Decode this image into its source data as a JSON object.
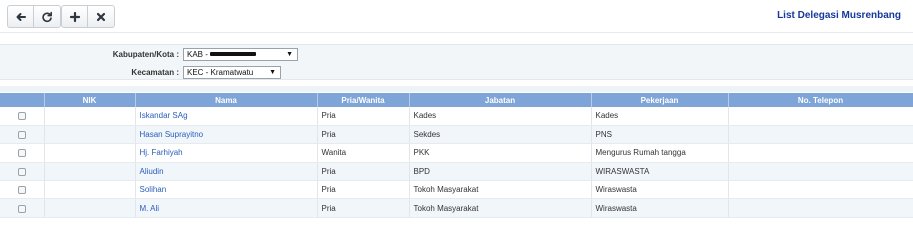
{
  "toolbar": {
    "back_icon": "arrow-left-icon",
    "refresh_icon": "refresh-icon",
    "add_icon": "plus-icon",
    "close_icon": "close-icon"
  },
  "page": {
    "title": "List Delegasi Musrenbang"
  },
  "filters": {
    "kabupaten": {
      "label": "Kabupaten/Kota :",
      "value": "KAB -"
    },
    "kecamatan": {
      "label": "Kecamatan :",
      "value": "KEC - Kramatwatu"
    }
  },
  "table": {
    "columns": [
      "NIK",
      "Nama",
      "Pria/Wanita",
      "Jabatan",
      "Pekerjaan",
      "No. Telepon"
    ],
    "rows": [
      {
        "nik": "",
        "nama": "Iskandar SAg",
        "gender": "Pria",
        "jabatan": "Kades",
        "pekerjaan": "Kades",
        "telepon": ""
      },
      {
        "nik": "",
        "nama": "Hasan Suprayitno",
        "gender": "Pria",
        "jabatan": "Sekdes",
        "pekerjaan": "PNS",
        "telepon": ""
      },
      {
        "nik": "",
        "nama": "Hj. Farhiyah",
        "gender": "Wanita",
        "jabatan": "PKK",
        "pekerjaan": "Mengurus Rumah tangga",
        "telepon": ""
      },
      {
        "nik": "",
        "nama": "Aliudin",
        "gender": "Pria",
        "jabatan": "BPD",
        "pekerjaan": "WIRASWASTA",
        "telepon": ""
      },
      {
        "nik": "",
        "nama": "Solihan",
        "gender": "Pria",
        "jabatan": "Tokoh Masyarakat",
        "pekerjaan": "Wiraswasta",
        "telepon": ""
      },
      {
        "nik": "",
        "nama": "M. Ali",
        "gender": "Pria",
        "jabatan": "Tokoh Masyarakat",
        "pekerjaan": "Wiraswasta",
        "telepon": ""
      }
    ]
  },
  "colors": {
    "header_bg": "#7ea4d8",
    "title": "#15389a",
    "link": "#2a5dba"
  }
}
